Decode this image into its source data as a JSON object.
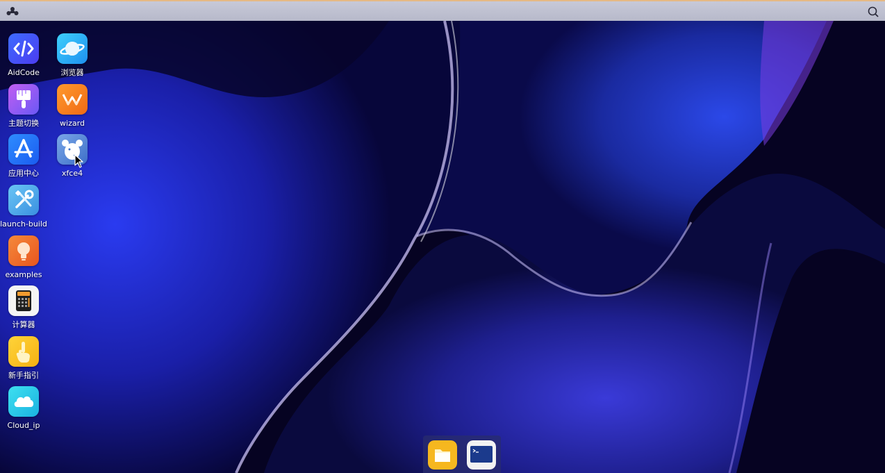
{
  "desktop": {
    "icons": [
      {
        "label": "AidCode",
        "icon": "code-icon",
        "color": "#3b5bff"
      },
      {
        "label": "浏览器",
        "icon": "planet-icon",
        "color": "#2fb3f5"
      },
      {
        "label": "主题切换",
        "icon": "paintbrush-icon",
        "color": "#a55cf0"
      },
      {
        "label": "wizard",
        "icon": "wizard-logo-icon",
        "color": "#f58220"
      },
      {
        "label": "应用中心",
        "icon": "app-store-icon",
        "color": "#1e7bff"
      },
      {
        "label": "xfce4",
        "icon": "xfce-mouse-icon",
        "color": "#5a8fd8"
      },
      {
        "label": "launch-build",
        "icon": "tools-icon",
        "color": "#5ab7f0"
      },
      {
        "label": "examples",
        "icon": "lightbulb-icon",
        "color": "#f06a2a"
      },
      {
        "label": "计算器",
        "icon": "calculator-icon",
        "color": "#f2f2f2"
      },
      {
        "label": "新手指引",
        "icon": "hand-pointer-icon",
        "color": "#f7c21d"
      },
      {
        "label": "Cloud_ip",
        "icon": "cloud-icon",
        "color": "#27cfe8"
      }
    ]
  },
  "topbar": {
    "logo_icon": "system-logo-icon",
    "search_icon": "search-icon"
  },
  "dock": {
    "items": [
      {
        "name": "file-manager",
        "icon": "folder-icon"
      },
      {
        "name": "terminal",
        "icon": "terminal-icon"
      }
    ]
  }
}
